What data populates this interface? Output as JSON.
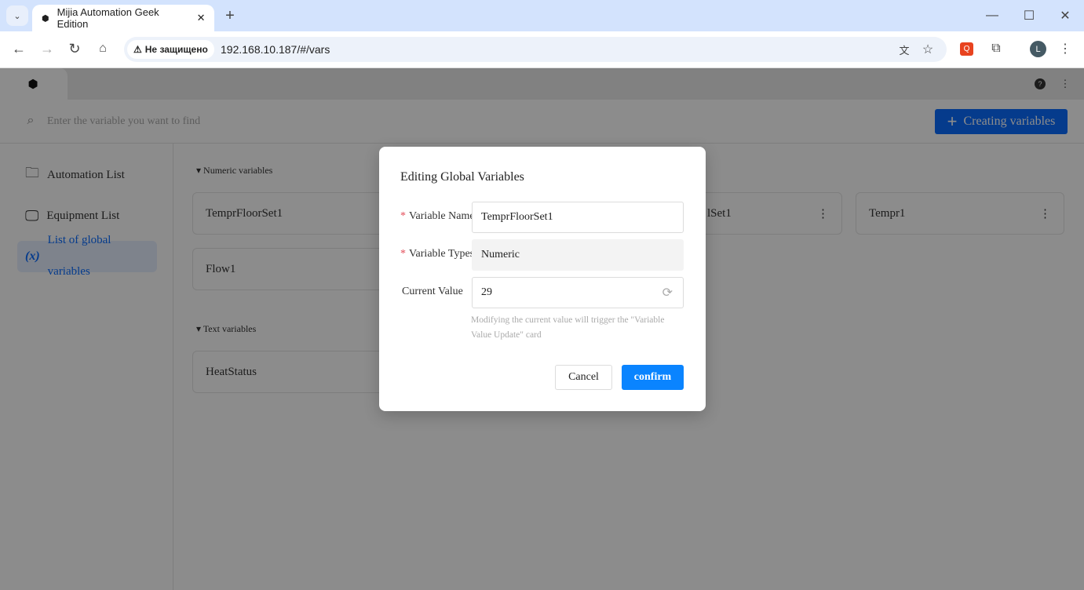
{
  "browser": {
    "tab_title": "Mijia Automation Geek Edition",
    "security_label": "Не защищено",
    "url": "192.168.10.187/#/vars",
    "profile_initial": "L"
  },
  "app": {
    "search_placeholder": "Enter the variable you want to find",
    "create_button": "Creating variables",
    "sidebar": {
      "items": [
        {
          "label": "Automation List",
          "icon": "folder-icon"
        },
        {
          "label": "Equipment List",
          "icon": "monitor-icon"
        },
        {
          "label": "List of global variables",
          "icon": "variable-icon",
          "active": true
        }
      ]
    },
    "numeric_section": "Numeric variables",
    "numeric_cards": [
      "TemprFloorSet1",
      "lSet1",
      "Tempr1",
      "Flow1"
    ],
    "text_section": "Text variables",
    "text_cards": [
      "HeatStatus"
    ]
  },
  "modal": {
    "title": "Editing Global Variables",
    "name_label": "Variable Name",
    "name_value": "TemprFloorSet1",
    "type_label": "Variable Types",
    "type_value": "Numeric",
    "value_label": "Current Value",
    "value_value": "29",
    "hint": "Modifying the current value will trigger the \"Variable Value Update\" card",
    "cancel": "Cancel",
    "confirm": "confirm"
  },
  "colors": {
    "primary": "#0a6cff",
    "required": "#e34d59"
  }
}
